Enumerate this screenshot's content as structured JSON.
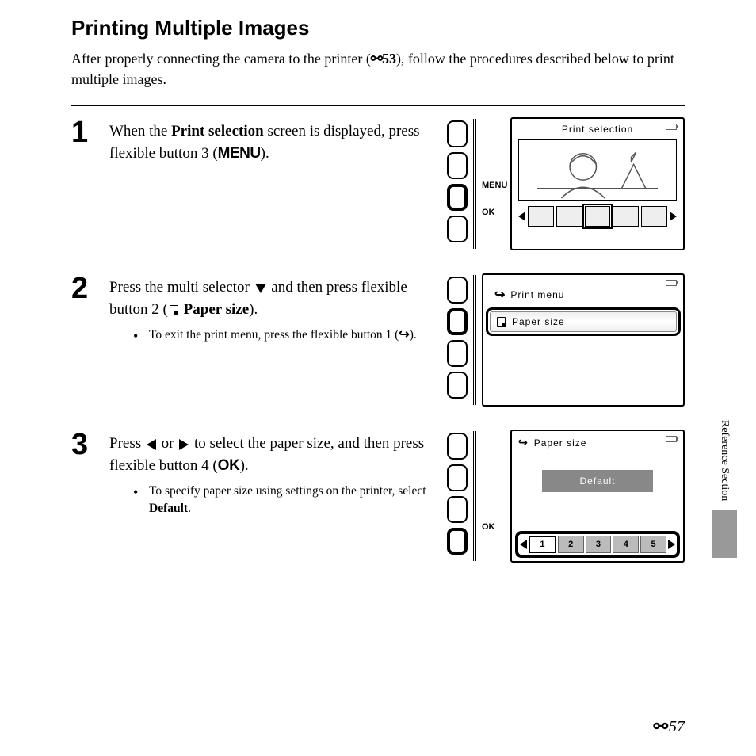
{
  "heading": "Printing Multiple Images",
  "intro_pre": "After properly connecting the camera to the printer (",
  "intro_ref": "53",
  "intro_post": "), follow the procedures described below to print multiple images.",
  "steps": [
    {
      "num": "1",
      "main_pre": "When the ",
      "main_bold1": "Print selection",
      "main_mid": " screen is displayed, press flexible button 3 (",
      "main_glyph": "MENU",
      "main_post": ")."
    },
    {
      "num": "2",
      "main_pre": "Press the multi selector ",
      "main_mid": " and then press flexible button 2 (",
      "main_bold1": "Paper size",
      "main_post": ").",
      "bullet_pre": "To exit the print menu, press the flexible button 1 (",
      "bullet_post": ")."
    },
    {
      "num": "3",
      "main_pre": "Press ",
      "main_mid": " or ",
      "main_mid2": " to select the paper size, and then press flexible button 4 (",
      "main_glyph": "OK",
      "main_post": ").",
      "bullet_pre": "To specify paper size using settings on the printer, select ",
      "bullet_bold": "Default",
      "bullet_post": "."
    }
  ],
  "screen1": {
    "title": "Print selection",
    "btn_menu": "MENU",
    "btn_ok": "OK"
  },
  "screen2": {
    "item1": "Print menu",
    "item2": "Paper size"
  },
  "screen3": {
    "title": "Paper size",
    "option": "Default",
    "btn_ok": "OK",
    "pages": [
      "1",
      "2",
      "3",
      "4",
      "5"
    ]
  },
  "side": "Reference Section",
  "footer_num": "57"
}
